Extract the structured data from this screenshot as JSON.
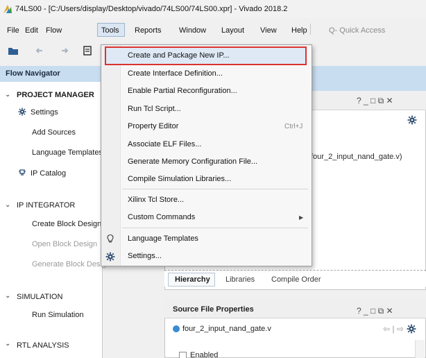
{
  "window": {
    "title": "74LS00 - [C:/Users/display/Desktop/vivado/74LS00/74LS00.xpr] - Vivado 2018.2"
  },
  "menubar": {
    "items": [
      "File",
      "Edit",
      "Flow",
      "Tools",
      "Reports",
      "Window",
      "Layout",
      "View",
      "Help"
    ],
    "active": "Tools",
    "quick_access": "Q- Quick Access"
  },
  "flow_navigator": {
    "title": "Flow Navigator",
    "sections": [
      {
        "label": "PROJECT MANAGER",
        "items": [
          "Settings",
          "Add Sources",
          "Language Templates",
          "IP Catalog"
        ]
      },
      {
        "label": "IP INTEGRATOR",
        "items": [
          "Create Block Design",
          "Open Block Design",
          "Generate Block Design"
        ]
      },
      {
        "label": "SIMULATION",
        "items": [
          "Run Simulation"
        ]
      },
      {
        "label": "RTL ANALYSIS",
        "items": []
      }
    ]
  },
  "tools_menu": {
    "items": [
      {
        "label": "Create and Package New IP...",
        "highlighted": true
      },
      {
        "label": "Create Interface Definition..."
      },
      {
        "label": "Enable Partial Reconfiguration..."
      },
      {
        "label": "Run Tcl Script..."
      },
      {
        "label": "Property Editor",
        "shortcut": "Ctrl+J"
      },
      {
        "label": "Associate ELF Files..."
      },
      {
        "label": "Generate Memory Configuration File..."
      },
      {
        "label": "Compile Simulation Libraries..."
      },
      {
        "label": "Xilinx Tcl Store..."
      },
      {
        "label": "Custom Commands",
        "submenu": true
      },
      {
        "label": "Language Templates"
      },
      {
        "label": "Settings..."
      }
    ]
  },
  "sources_panel": {
    "file_fragment": "four_2_input_nand_gate.v)",
    "tabs": [
      "Hierarchy",
      "Libraries",
      "Compile Order"
    ],
    "active_tab": "Hierarchy"
  },
  "source_file_properties": {
    "title": "Source File Properties",
    "file": "four_2_input_nand_gate.v",
    "enabled_label": "Enabled"
  },
  "window_controls": "? _ □ ⧉ ✕",
  "nav_arrows": "⇦ | ⇨",
  "colors": {
    "highlight_border": "#d9332f",
    "header_blue": "#c8ddf0",
    "file_dot": "#3b8bd0"
  }
}
